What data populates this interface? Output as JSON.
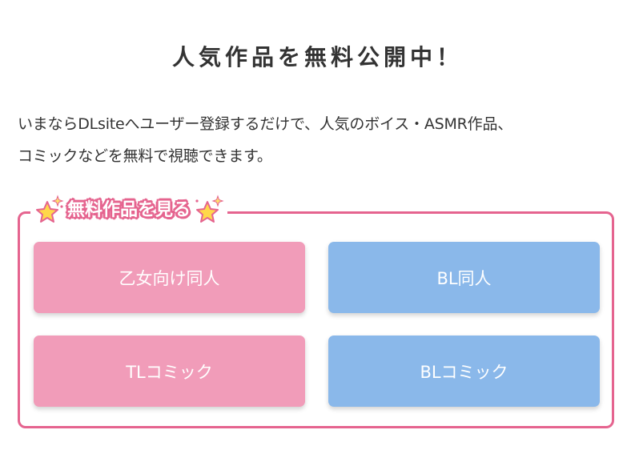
{
  "heading": "人気作品を無料公開中！",
  "intro": {
    "line1": "いまならDLsiteへユーザー登録するだけで、人気のボイス・ASMR作品、",
    "line2": "コミックなどを無料で視聴できます。"
  },
  "free_section": {
    "title": "無料作品を見る",
    "buttons": [
      {
        "label": "乙女向け同人",
        "color": "#f19cb9"
      },
      {
        "label": "BL同人",
        "color": "#8ab8ea"
      },
      {
        "label": "TLコミック",
        "color": "#f19cb9"
      },
      {
        "label": "BLコミック",
        "color": "#8ab8ea"
      }
    ]
  },
  "colors": {
    "accent_border": "#e5648f",
    "pink_button": "#f19cb9",
    "blue_button": "#8ab8ea",
    "text": "#333333",
    "star": "#ffd84a"
  },
  "icons": [
    "sparkle-star-icon",
    "sparkle-star-icon"
  ]
}
